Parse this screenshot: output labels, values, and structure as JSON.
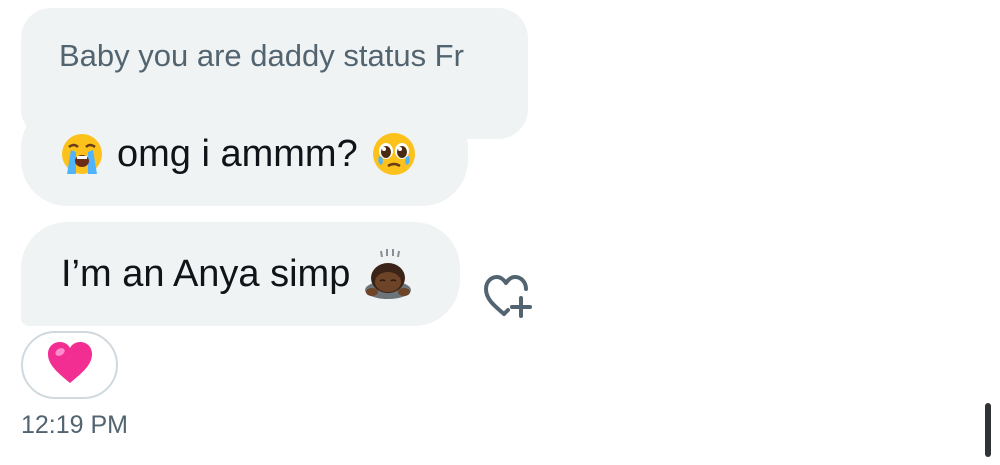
{
  "conversation": {
    "quoted_message": {
      "text": "Baby you are daddy status Fr"
    },
    "messages": [
      {
        "leading_emoji": "sob-face-emoji",
        "text": "omg i ammm?",
        "trailing_emoji": "pleading-face-emoji"
      },
      {
        "text": "I’m an Anya simp",
        "trailing_emoji": "person-bowing-emoji"
      }
    ],
    "add_reaction_icon": "heart-plus-icon",
    "reaction": {
      "emoji": "pink-heart-emoji"
    },
    "timestamp": "12:19 PM"
  },
  "colors": {
    "bubble_background": "#eff3f4",
    "quoted_text": "#536471",
    "message_text": "#0f1419",
    "reaction_border": "#cfd9de",
    "pink_heart": "#f22e93",
    "timestamp_text": "#536471"
  }
}
